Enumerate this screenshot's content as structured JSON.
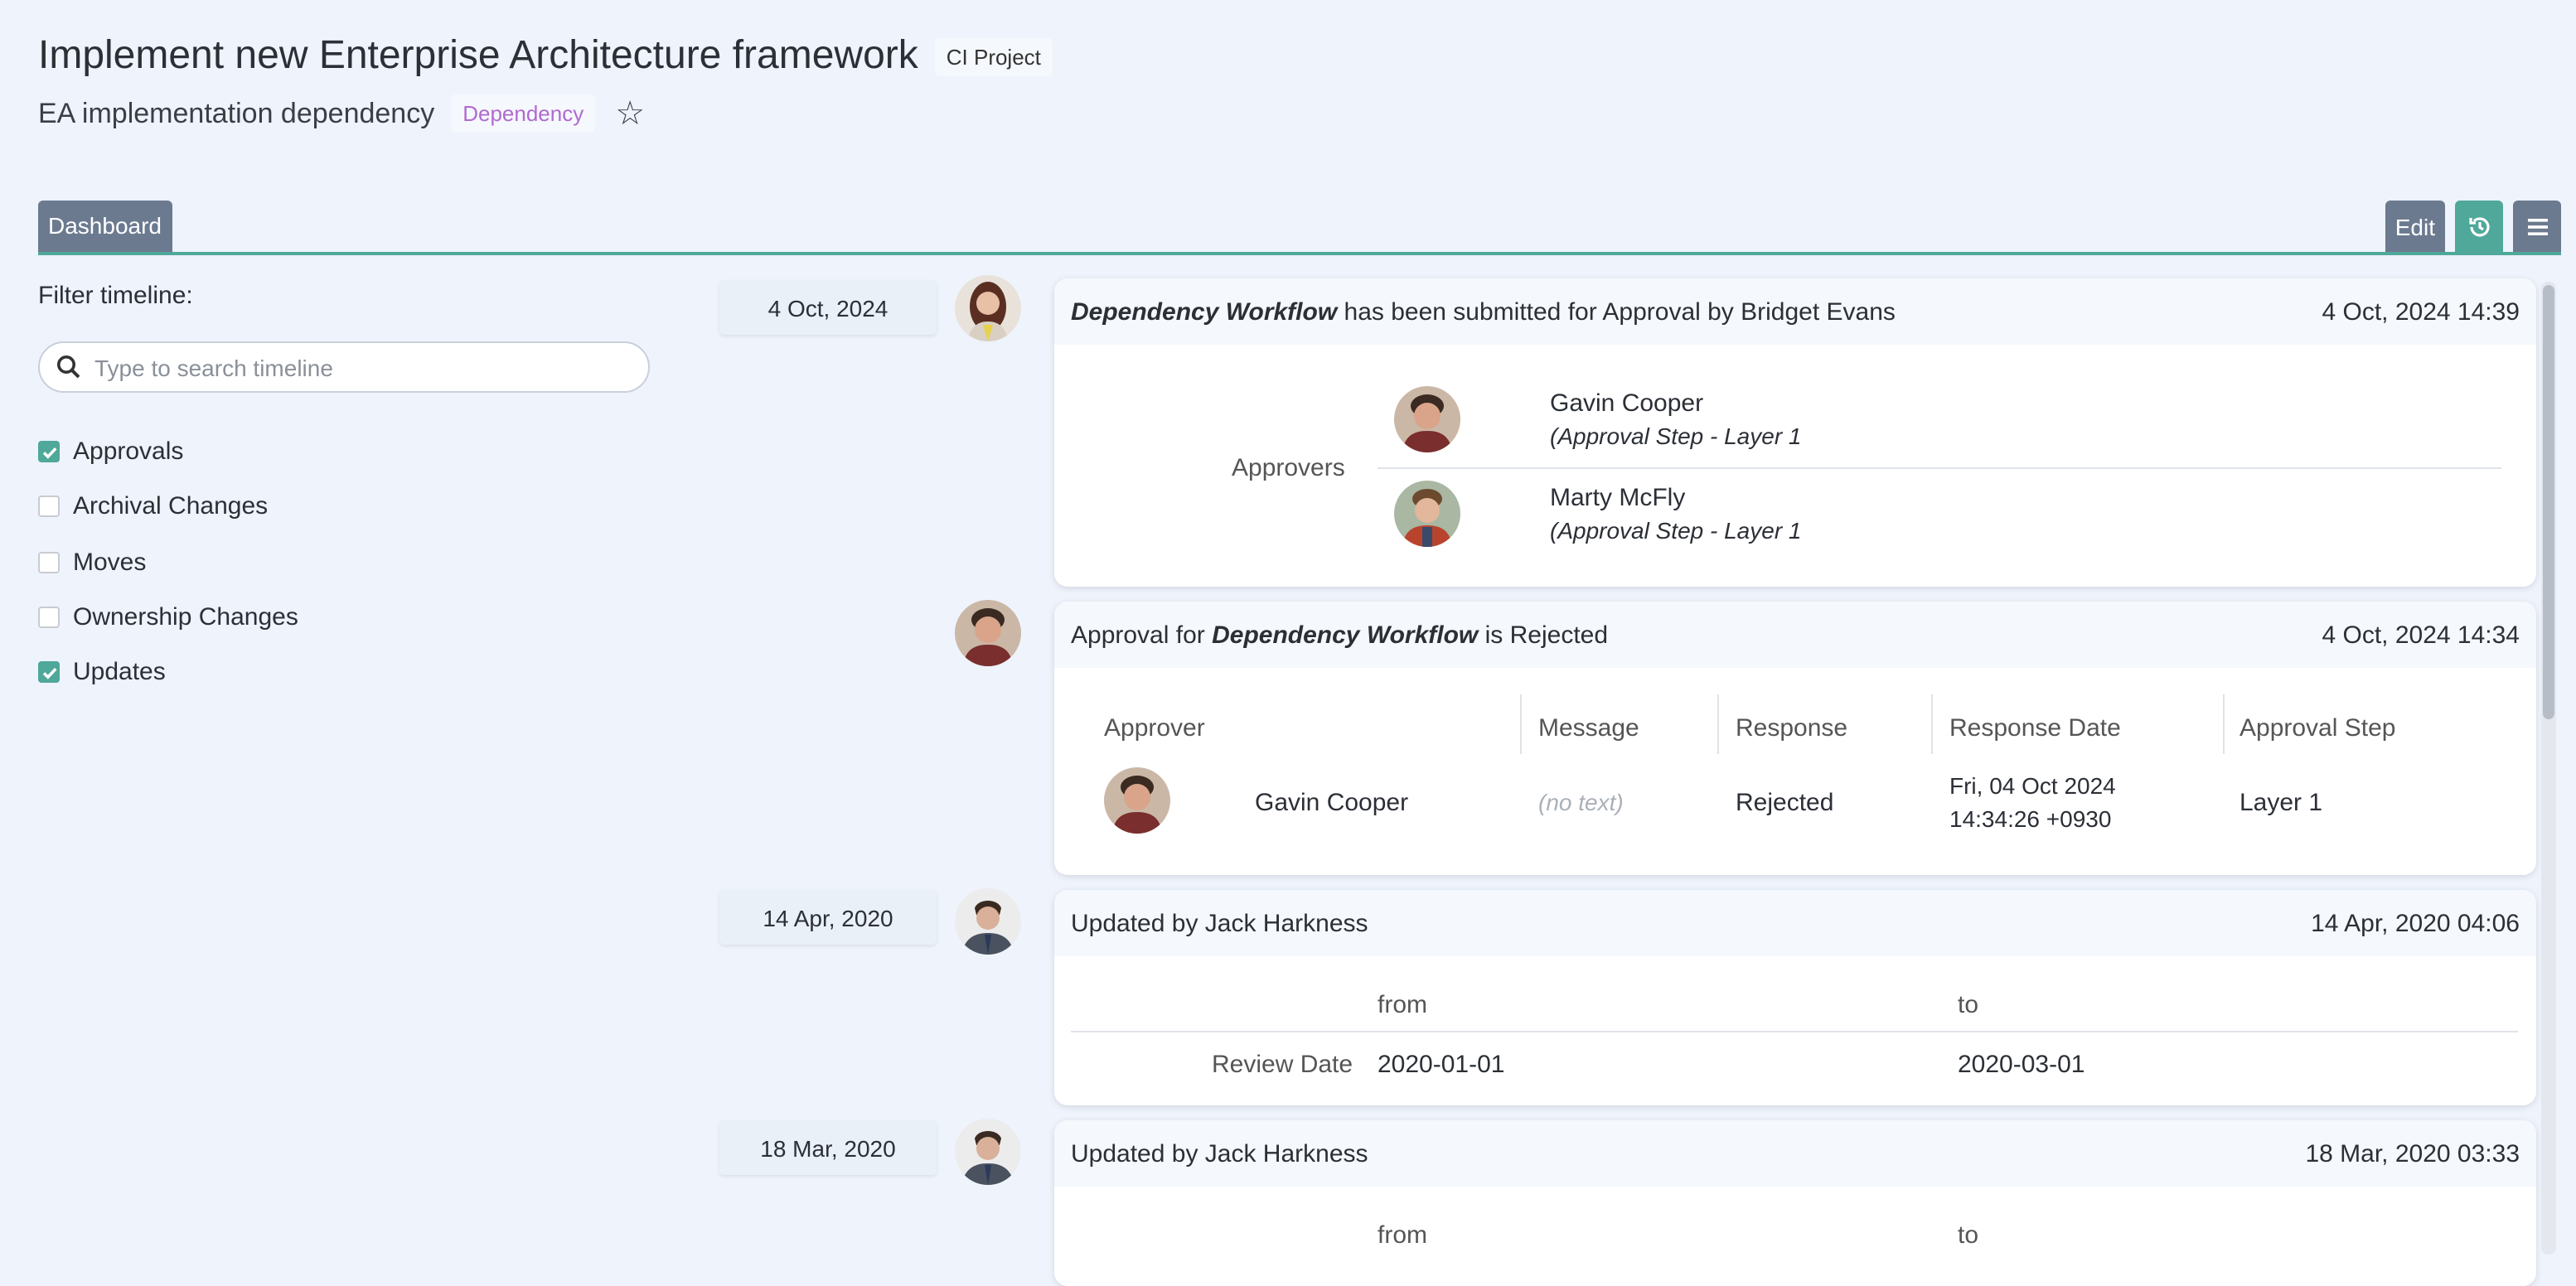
{
  "header": {
    "title": "Implement new Enterprise Architecture framework",
    "type_badge": "CI Project",
    "subtitle": "EA implementation dependency",
    "subtype_badge": "Dependency"
  },
  "tabs": {
    "active": "Dashboard"
  },
  "toolbar": {
    "edit_label": "Edit",
    "history_icon": "history-icon",
    "menu_icon": "menu-icon"
  },
  "filter": {
    "label": "Filter timeline:",
    "search_placeholder": "Type to search timeline",
    "options": [
      {
        "label": "Approvals",
        "checked": true
      },
      {
        "label": "Archival Changes",
        "checked": false
      },
      {
        "label": "Moves",
        "checked": false
      },
      {
        "label": "Ownership Changes",
        "checked": false
      },
      {
        "label": "Updates",
        "checked": true
      }
    ]
  },
  "timeline": {
    "e1": {
      "date": "4 Oct, 2024",
      "title_workflow": "Dependency Workflow",
      "title_rest": " has been submitted for Approval by Bridget Evans",
      "timestamp": "4 Oct, 2024 14:39",
      "approvers_label": "Approvers",
      "approvers": [
        {
          "name": "Gavin Cooper",
          "step": "(Approval Step - Layer 1"
        },
        {
          "name": "Marty McFly",
          "step": "(Approval Step - Layer 1"
        }
      ]
    },
    "e2": {
      "title_prefix": "Approval for ",
      "title_workflow": "Dependency Workflow",
      "title_suffix": " is Rejected",
      "timestamp": "4 Oct, 2024 14:34",
      "columns": [
        "Approver",
        "Message",
        "Response",
        "Response Date",
        "Approval Step"
      ],
      "row": {
        "approver": "Gavin Cooper",
        "message": "(no text)",
        "response": "Rejected",
        "date_line1": "Fri, 04 Oct 2024",
        "date_line2": "14:34:26 +0930",
        "step": "Layer 1"
      }
    },
    "e3": {
      "date": "14 Apr, 2020",
      "title": "Updated by Jack Harkness",
      "timestamp": "14 Apr, 2020 04:06",
      "from_label": "from",
      "to_label": "to",
      "field": "Review Date",
      "from_value": "2020-01-01",
      "to_value": "2020-03-01"
    },
    "e4": {
      "date": "18 Mar, 2020",
      "title": "Updated by Jack Harkness",
      "timestamp": "18 Mar, 2020 03:33",
      "from_label": "from",
      "to_label": "to"
    }
  },
  "colors": {
    "accent": "#4fa89a",
    "tab": "#6c7a90",
    "badge_dependency": "#b06ad1",
    "background": "#eef3fc"
  }
}
